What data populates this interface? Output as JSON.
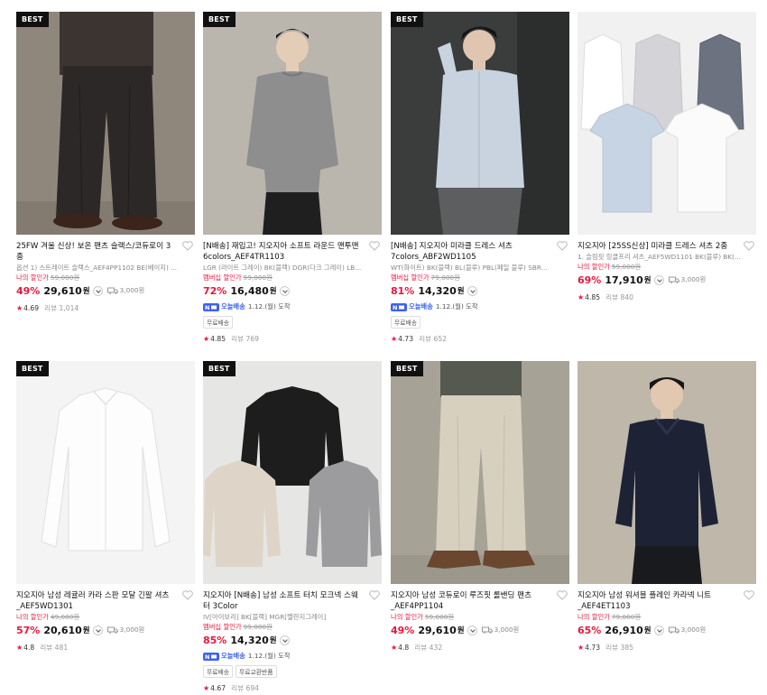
{
  "products": [
    {
      "best": "BEST",
      "title": "25FW 겨울 신상! 보온 팬츠 슬랙스/코듀로이 3종",
      "subtitle": "옵션 1) 스트레이트 슬랙스_AEF4PP1102 BE(베이지) ...",
      "deal_label": "나의 할인가",
      "original_price": "59,000원",
      "discount": "49%",
      "price": "29,610",
      "won": "원",
      "shipping": "3,000원",
      "rating": "4.69",
      "review_label": "리뷰",
      "review_count": "1,014",
      "image": "pants-dark-icon",
      "bg": "#8d857a"
    },
    {
      "best": "BEST",
      "title": "[N배송] 재입고! 지오지아 소프트 라운드 맨투맨 6colors_AEF4TR1103",
      "subtitle": "LGR (라이트 그레이) BK(블랙) DGR(다크 그레이) LB...",
      "deal_label": "멤버십 할인가",
      "original_price": "59,000원",
      "discount": "72%",
      "price": "16,480",
      "won": "원",
      "delivery_tag": "오늘배송",
      "delivery_date": "1.12.(월) 도착",
      "badges": [
        "무료배송"
      ],
      "rating": "4.85",
      "review_label": "리뷰",
      "review_count": "769",
      "image": "sweatshirt-grey-icon",
      "bg": "#b9b4ac"
    },
    {
      "best": "BEST",
      "title": "[N배송] 지오지아 미라클 드레스 셔츠 7colors_ABF2WD1105",
      "subtitle": "WT(화이트) BK(블랙) BL(블루) PBL(페일 블루) SBR...",
      "deal_label": "멤버십 할인가",
      "original_price": "79,000원",
      "discount": "81%",
      "price": "14,320",
      "won": "원",
      "delivery_tag": "오늘배송",
      "delivery_date": "1.12.(월) 도착",
      "badges": [
        "무료배송"
      ],
      "rating": "4.73",
      "review_label": "리뷰",
      "review_count": "652",
      "image": "dress-shirt-icon",
      "bg": "#3a3d3c"
    },
    {
      "title": "지오지아 [25SS신상] 미라클 드레스 셔츠 2종",
      "subtitle": "1. 슬림핏 링클프리 셔츠_AEF5WD1101 BK(블루) BK(...",
      "deal_label": "나의 할인가",
      "original_price": "59,000원",
      "discount": "69%",
      "price": "17,910",
      "won": "원",
      "shipping": "3,000원",
      "rating": "4.85",
      "review_label": "리뷰",
      "review_count": "840",
      "image": "shirts-flatlay-icon",
      "bg": "#f1f1f1"
    },
    {
      "best": "BEST",
      "title": "지오지아 남성 레귤러 카라 스판 모달 긴팔 셔츠 _AEF5WD1301",
      "deal_label": "나의 할인가",
      "original_price": "49,000원",
      "discount": "57%",
      "price": "20,610",
      "won": "원",
      "shipping": "3,000원",
      "rating": "4.8",
      "review_label": "리뷰",
      "review_count": "481",
      "image": "white-shirt-icon",
      "bg": "#f4f4f4"
    },
    {
      "best": "BEST",
      "title": "지오지아 [N배송] 남성 소프트 터치 모크넥 스웨터 3Color",
      "subtitle": "IV[아이보리] BK[블랙] MGR[멜란지그레이]",
      "deal_label": "멤버십 할인가",
      "original_price": "99,000원",
      "discount": "85%",
      "price": "14,320",
      "won": "원",
      "delivery_tag": "오늘배송",
      "delivery_date": "1.12.(월) 도착",
      "badges": [
        "무료배송",
        "무료교환반품"
      ],
      "rating": "4.67",
      "review_label": "리뷰",
      "review_count": "694",
      "image": "sweaters-trio-icon",
      "bg": "#e6e6e4"
    },
    {
      "best": "BEST",
      "title": "지오지아 남성 코듀로이 루즈핏 롤밴딩 팬츠 _AEF4PP1104",
      "deal_label": "나의 할인가",
      "original_price": "59,000원",
      "discount": "49%",
      "price": "29,610",
      "won": "원",
      "shipping": "3,000원",
      "rating": "4.8",
      "review_label": "리뷰",
      "review_count": "432",
      "image": "beige-pants-icon",
      "bg": "#a5a195"
    },
    {
      "title": "지오지아 남성 워셔블 플레인 카라넥 니트 _AEF4ET1103",
      "deal_label": "나의 할인가",
      "original_price": "79,000원",
      "discount": "65%",
      "price": "26,910",
      "won": "원",
      "shipping": "3,000원",
      "rating": "4.73",
      "review_label": "리뷰",
      "review_count": "385",
      "image": "navy-knit-icon",
      "bg": "#bdb6a9"
    }
  ],
  "colors": {
    "accent": "#e8173d",
    "delivery": "#3c62f0"
  }
}
